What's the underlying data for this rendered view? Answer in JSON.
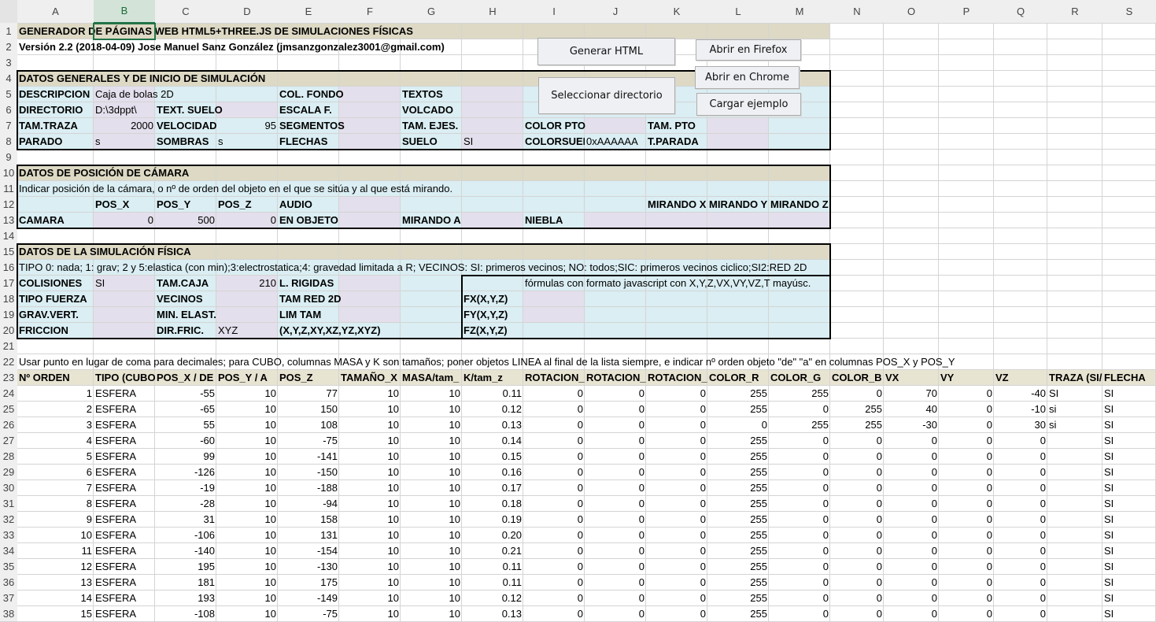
{
  "column_headers": [
    "A",
    "B",
    "C",
    "D",
    "E",
    "F",
    "G",
    "H",
    "I",
    "J",
    "K",
    "L",
    "M",
    "N",
    "O",
    "P",
    "Q",
    "R",
    "S"
  ],
  "row_numbers": [
    "1",
    "2",
    "3",
    "4",
    "5",
    "6",
    "7",
    "8",
    "9",
    "10",
    "11",
    "12",
    "13",
    "14",
    "15",
    "16",
    "17",
    "18",
    "19",
    "20",
    "21",
    "22",
    "23",
    "24",
    "25",
    "26",
    "27",
    "28",
    "29",
    "30",
    "31",
    "32",
    "33",
    "34",
    "35",
    "36",
    "37",
    "38"
  ],
  "selected_column": "B",
  "buttons": {
    "generar_html": "Generar HTML",
    "abrir_firefox": "Abrir en Firefox",
    "abrir_chrome": "Abrir en Chrome",
    "seleccionar_directorio": "Seleccionar directorio",
    "cargar_ejemplo": "Cargar ejemplo"
  },
  "colors": {
    "section_header": "#ddd9c4",
    "light_blue": "#daeef3",
    "lavender": "#e4dfec",
    "selection": "#217346"
  },
  "rows": {
    "r1": {
      "A": "GENERADOR DE PÁGINAS WEB HTML5+THREE.JS DE SIMULACIONES FÍSICAS"
    },
    "r2": {
      "A": "Versión 2.2 (2018-04-09) Jose Manuel Sanz González (jmsanzgonzalez3001@gmail.com)"
    },
    "r4": {
      "A": "DATOS GENERALES Y DE INICIO DE SIMULACIÓN"
    },
    "r5": {
      "A": "DESCRIPCION",
      "B": "Caja de bolas 2D",
      "E": "COL. FONDO",
      "G": "TEXTOS"
    },
    "r6": {
      "A": "DIRECTORIO",
      "B": "D:\\3dppt\\",
      "C": "TEXT. SUELO",
      "E": "ESCALA F.",
      "G": "VOLCADO"
    },
    "r7": {
      "A": "TAM.TRAZA",
      "B": "2000",
      "C": "VELOCIDAD",
      "D": "95",
      "E": "SEGMENTOS",
      "G": "TAM. EJES.",
      "I": "COLOR PTO",
      "K": "TAM. PTO"
    },
    "r8": {
      "A": "PARADO",
      "B": "s",
      "C": "SOMBRAS",
      "D": "s",
      "E": "FLECHAS",
      "G": "SUELO",
      "H": "SI",
      "I": "COLORSUELO",
      "J": "0xAAAAAA",
      "K": "T.PARADA"
    },
    "r10": {
      "A": "DATOS DE POSICIÓN DE CÁMARA"
    },
    "r11": {
      "A": "Indicar posición de la cámara, o nº de orden del objeto en el que se sitúa y al que está mirando."
    },
    "r12": {
      "B": "POS_X",
      "C": "POS_Y",
      "D": "POS_Z",
      "E": "AUDIO",
      "K": "MIRANDO X",
      "L": "MIRANDO Y",
      "M": "MIRANDO Z"
    },
    "r13": {
      "A": "CAMARA",
      "B": "0",
      "C": "500",
      "D": "0",
      "E": "EN OBJETO",
      "G": "MIRANDO A",
      "I": "NIEBLA"
    },
    "r15": {
      "A": "DATOS DE LA SIMULACIÓN FÍSICA"
    },
    "r16": {
      "A": "TIPO 0: nada; 1: grav; 2 y 5:elastica (con min);3:electrostatica;4: gravedad limitada a R; VECINOS: SI: primeros vecinos; NO: todos;SIC: primeros vecinos ciclico;SI2:RED 2D"
    },
    "r17": {
      "A": "COLISIONES",
      "B": "SI",
      "C": "TAM.CAJA",
      "D": "210",
      "E": "L. RIGIDAS",
      "I": "fórmulas con formato javascript con X,Y,Z,VX,VY,VZ,T mayúsc."
    },
    "r18": {
      "A": "TIPO FUERZA",
      "C": "VECINOS",
      "E": "TAM RED 2D",
      "H": "FX(X,Y,Z)"
    },
    "r19": {
      "A": "GRAV.VERT.",
      "C": "MIN. ELAST.",
      "E": "LIM TAM",
      "H": "FY(X,Y,Z)"
    },
    "r20": {
      "A": "FRICCION",
      "C": "DIR.FRIC.",
      "D": "XYZ",
      "E": "(X,Y,Z,XY,XZ,YZ,XYZ)",
      "H": "FZ(X,Y,Z)"
    },
    "r22": {
      "A": "Usar punto en lugar de coma para decimales; para CUBO, columnas MASA y K son tamaños; poner objetos LINEA al final de la lista siempre, e indicar nº orden objeto \"de\" \"a\" en columnas POS_X y POS_Y"
    }
  },
  "table": {
    "headers": [
      "Nº ORDEN",
      "TIPO (CUBO,",
      "POS_X / DE",
      "POS_Y / A",
      "POS_Z",
      "TAMAÑO_X",
      "MASA/tam_",
      "K/tam_z",
      "ROTACION_",
      "ROTACION_",
      "ROTACION_",
      "COLOR_R",
      "COLOR_G",
      "COLOR_B",
      "VX",
      "VY",
      "VZ",
      "TRAZA (SI/",
      "FLECHA"
    ],
    "rows": [
      [
        "1",
        "ESFERA",
        "-55",
        "10",
        "77",
        "10",
        "10",
        "0.11",
        "0",
        "0",
        "0",
        "255",
        "255",
        "0",
        "70",
        "0",
        "-40",
        "SI",
        "SI"
      ],
      [
        "2",
        "ESFERA",
        "-65",
        "10",
        "150",
        "10",
        "10",
        "0.12",
        "0",
        "0",
        "0",
        "255",
        "0",
        "255",
        "40",
        "0",
        "-10",
        "si",
        "SI"
      ],
      [
        "3",
        "ESFERA",
        "55",
        "10",
        "108",
        "10",
        "10",
        "0.13",
        "0",
        "0",
        "0",
        "0",
        "255",
        "255",
        "-30",
        "0",
        "30",
        "si",
        "SI"
      ],
      [
        "4",
        "ESFERA",
        "-60",
        "10",
        "-75",
        "10",
        "10",
        "0.14",
        "0",
        "0",
        "0",
        "255",
        "0",
        "0",
        "0",
        "0",
        "0",
        "",
        "SI"
      ],
      [
        "5",
        "ESFERA",
        "99",
        "10",
        "-141",
        "10",
        "10",
        "0.15",
        "0",
        "0",
        "0",
        "255",
        "0",
        "0",
        "0",
        "0",
        "0",
        "",
        "SI"
      ],
      [
        "6",
        "ESFERA",
        "-126",
        "10",
        "-150",
        "10",
        "10",
        "0.16",
        "0",
        "0",
        "0",
        "255",
        "0",
        "0",
        "0",
        "0",
        "0",
        "",
        "SI"
      ],
      [
        "7",
        "ESFERA",
        "-19",
        "10",
        "-188",
        "10",
        "10",
        "0.17",
        "0",
        "0",
        "0",
        "255",
        "0",
        "0",
        "0",
        "0",
        "0",
        "",
        "SI"
      ],
      [
        "8",
        "ESFERA",
        "-28",
        "10",
        "-94",
        "10",
        "10",
        "0.18",
        "0",
        "0",
        "0",
        "255",
        "0",
        "0",
        "0",
        "0",
        "0",
        "",
        "SI"
      ],
      [
        "9",
        "ESFERA",
        "31",
        "10",
        "158",
        "10",
        "10",
        "0.19",
        "0",
        "0",
        "0",
        "255",
        "0",
        "0",
        "0",
        "0",
        "0",
        "",
        "SI"
      ],
      [
        "10",
        "ESFERA",
        "-106",
        "10",
        "131",
        "10",
        "10",
        "0.20",
        "0",
        "0",
        "0",
        "255",
        "0",
        "0",
        "0",
        "0",
        "0",
        "",
        "SI"
      ],
      [
        "11",
        "ESFERA",
        "-140",
        "10",
        "-154",
        "10",
        "10",
        "0.21",
        "0",
        "0",
        "0",
        "255",
        "0",
        "0",
        "0",
        "0",
        "0",
        "",
        "SI"
      ],
      [
        "12",
        "ESFERA",
        "195",
        "10",
        "-130",
        "10",
        "10",
        "0.11",
        "0",
        "0",
        "0",
        "255",
        "0",
        "0",
        "0",
        "0",
        "0",
        "",
        "SI"
      ],
      [
        "13",
        "ESFERA",
        "181",
        "10",
        "175",
        "10",
        "10",
        "0.11",
        "0",
        "0",
        "0",
        "255",
        "0",
        "0",
        "0",
        "0",
        "0",
        "",
        "SI"
      ],
      [
        "14",
        "ESFERA",
        "193",
        "10",
        "-149",
        "10",
        "10",
        "0.12",
        "0",
        "0",
        "0",
        "255",
        "0",
        "0",
        "0",
        "0",
        "0",
        "",
        "SI"
      ],
      [
        "15",
        "ESFERA",
        "-108",
        "10",
        "-75",
        "10",
        "10",
        "0.13",
        "0",
        "0",
        "0",
        "255",
        "0",
        "0",
        "0",
        "0",
        "0",
        "",
        "SI"
      ]
    ]
  }
}
